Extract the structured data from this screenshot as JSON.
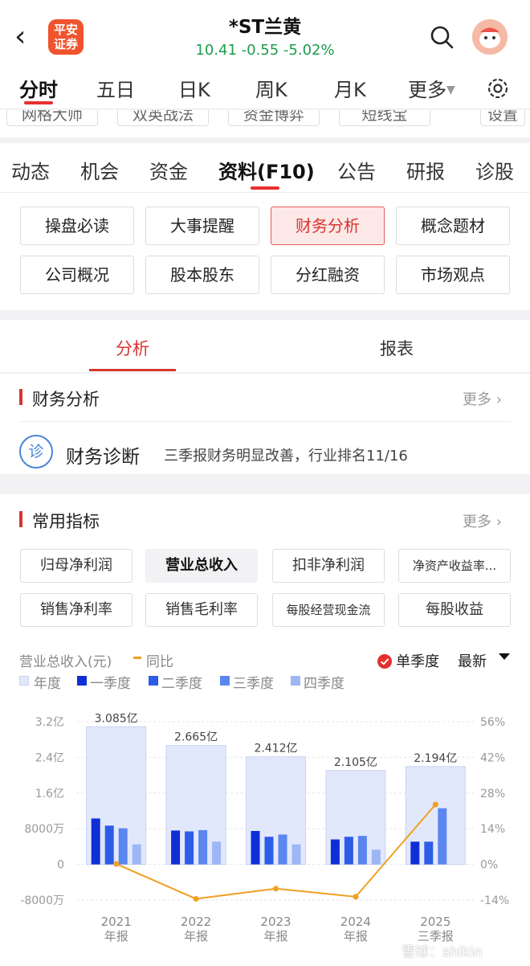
{
  "header": {
    "back_glyph": "‹",
    "logo_text": "平安\n证券",
    "stock_name": "*ST兰黄",
    "quote": "10.41 -0.55 -5.02%"
  },
  "time_tabs": [
    "分时",
    "五日",
    "日K",
    "周K",
    "月K",
    "更多"
  ],
  "tools": [
    "网格大师",
    "双英战法",
    "资金博弈",
    "短线宝",
    "设置"
  ],
  "f10_tabs": [
    "动态",
    "机会",
    "资金",
    "资料(F10)",
    "公告",
    "研报",
    "诊股"
  ],
  "modules": [
    "操盘必读",
    "大事提醒",
    "财务分析",
    "概念题材",
    "公司概况",
    "股本股东",
    "分红融资",
    "市场观点"
  ],
  "sub_tabs": [
    "分析",
    "报表"
  ],
  "financial_analysis": {
    "title": "财务分析",
    "more": "更多",
    "diag_icon_text": "诊",
    "diag_title": "财务诊断",
    "diag_desc": "三季报财务明显改善，行业排名11/16"
  },
  "indicators": {
    "title": "常用指标",
    "more": "更多",
    "chips": [
      "归母净利润",
      "营业总收入",
      "扣非净利润",
      "净资产收益率...",
      "销售净利率",
      "销售毛利率",
      "每股经营现金流",
      "每股收益"
    ],
    "caption_left": "营业总收入(元)",
    "caption_yoy": "同比",
    "single_quarter": "单季度",
    "latest": "最新",
    "legend": [
      "年度",
      "一季度",
      "二季度",
      "三季度",
      "四季度"
    ]
  },
  "colors": {
    "annual": "#e2e8fb",
    "q1": "#0f2fd6",
    "q2": "#2d5ce8",
    "q3": "#5b86ef",
    "q4": "#9db6f5",
    "yoy": "#f0a020",
    "accent": "#d8352f"
  },
  "chart_data": {
    "type": "bar",
    "categories": [
      "2021\n年报",
      "2022\n年报",
      "2023\n年报",
      "2024\n年报",
      "2025\n三季报"
    ],
    "y_left_ticks": [
      "3.2亿",
      "2.4亿",
      "1.6亿",
      "8000万",
      "0",
      "-8000万"
    ],
    "y_right_ticks": [
      "56%",
      "42%",
      "28%",
      "14%",
      "0%",
      "-14%"
    ],
    "ylim_left_wan": [
      -8000,
      32000
    ],
    "ylim_right_pct": [
      -14,
      56
    ],
    "annual_labels": [
      "3.085亿",
      "2.665亿",
      "2.412亿",
      "2.105亿",
      "2.194亿"
    ],
    "series": [
      {
        "name": "年度",
        "values": [
          30850,
          26650,
          24120,
          21050,
          21940
        ]
      },
      {
        "name": "一季度",
        "values": [
          10300,
          7600,
          7500,
          5600,
          5100
        ]
      },
      {
        "name": "二季度",
        "values": [
          8700,
          7400,
          6200,
          6200,
          5100
        ]
      },
      {
        "name": "三季度",
        "values": [
          8100,
          7700,
          6700,
          6400,
          12600
        ]
      },
      {
        "name": "四季度",
        "values": [
          4500,
          5100,
          4500,
          3300,
          null
        ]
      },
      {
        "name": "同比",
        "values": [
          0.2,
          -13.5,
          -9.5,
          -12.7,
          23.5
        ]
      }
    ]
  },
  "watermark": "雪球：shikin"
}
